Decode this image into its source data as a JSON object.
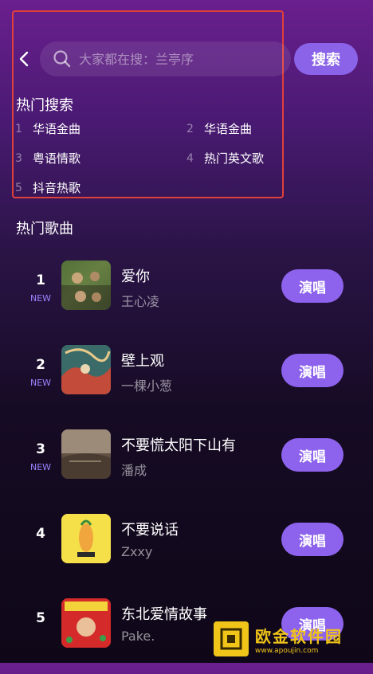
{
  "header": {
    "search_placeholder": "大家都在搜：兰亭序",
    "search_button": "搜索"
  },
  "hot_search": {
    "title": "热门搜索",
    "items": [
      {
        "index": "1",
        "text": "华语金曲"
      },
      {
        "index": "2",
        "text": "华语金曲"
      },
      {
        "index": "3",
        "text": "粤语情歌"
      },
      {
        "index": "4",
        "text": "热门英文歌"
      },
      {
        "index": "5",
        "text": "抖音热歌"
      }
    ]
  },
  "hot_songs": {
    "title": "热门歌曲",
    "sing_label": "演唱",
    "songs": [
      {
        "rank": "1",
        "badge": "NEW",
        "title": "爱你",
        "artist": "王心凌"
      },
      {
        "rank": "2",
        "badge": "NEW",
        "title": "壁上观",
        "artist": "一棵小葱"
      },
      {
        "rank": "3",
        "badge": "NEW",
        "title": "不要慌太阳下山有",
        "artist": "潘成"
      },
      {
        "rank": "4",
        "badge": "",
        "title": "不要说话",
        "artist": "Zxxy"
      },
      {
        "rank": "5",
        "badge": "",
        "title": "东北爱情故事",
        "artist": "Pake."
      }
    ]
  },
  "watermark": {
    "name": "欧金软件园",
    "url": "www.apoujin.com"
  },
  "colors": {
    "accent": "#8d62ec",
    "highlight_border": "#e0403a"
  }
}
